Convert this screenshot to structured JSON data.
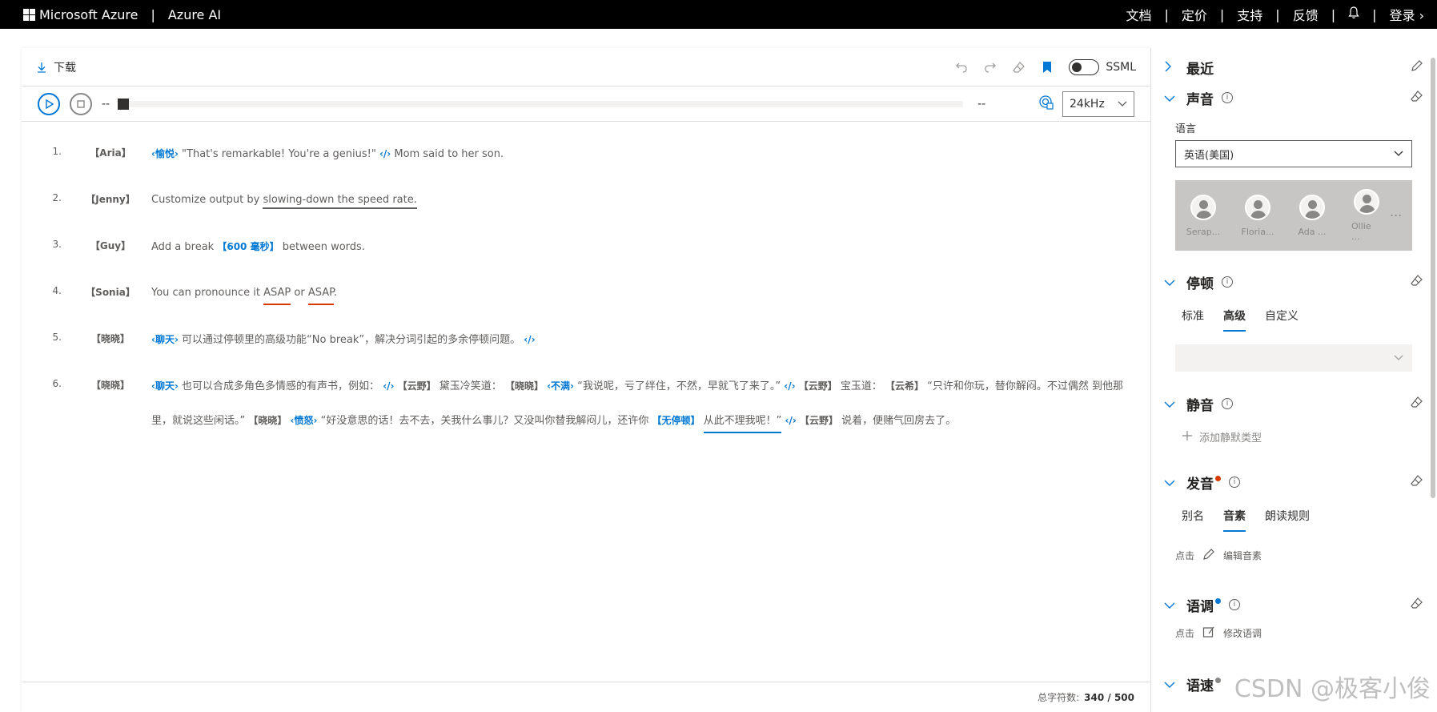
{
  "topbar": {
    "brand": "Microsoft Azure",
    "separator": "|",
    "product": "Azure AI",
    "nav": [
      "文档",
      "定价",
      "支持",
      "反馈"
    ],
    "signin": "登录",
    "bell_icon": "bell-icon"
  },
  "toolbar": {
    "download": "下载",
    "ssml": "SSML"
  },
  "player": {
    "time_current": "--",
    "time_total": "--",
    "sample_rate": "24kHz",
    "progress": 0
  },
  "editor": {
    "lines": [
      {
        "num": "1.",
        "speaker": "【Aria】",
        "parts": [
          "‹愉悦›",
          "\"That's remarkable! You're a genius!\"",
          "‹/›",
          "Mom said to her son."
        ]
      },
      {
        "num": "2.",
        "speaker": "【Jenny】",
        "parts": [
          "Customize output by",
          "slowing-down the speed rate."
        ]
      },
      {
        "num": "3.",
        "speaker": "【Guy】",
        "parts": [
          "Add a break",
          "【600 毫秒】",
          "between words."
        ]
      },
      {
        "num": "4.",
        "speaker": "【Sonia】",
        "parts": [
          "You can pronounce it",
          "ASAP",
          "or",
          "ASAP",
          "."
        ]
      },
      {
        "num": "5.",
        "speaker": "【晓晓】",
        "parts": [
          "‹聊天›",
          "可以通过停顿里的高级功能“No break”，解决分词引起的多余停顿问题。",
          "‹/›"
        ]
      },
      {
        "num": "6.",
        "speaker": "【晓晓】",
        "parts": [
          "‹聊天›",
          "也可以合成多角色多情感的有声书，例如：",
          "‹/›",
          "【云野】",
          "黛玉冷笑道：",
          "【晓晓】",
          "‹不满›",
          "“我说呢，亏了绊住，不然，早就飞了来了。”",
          "‹/›",
          "【云野】",
          "宝玉道：",
          "【云希】",
          "“只许和你玩，替你解闷。不过偶然",
          "到他那里，就说这些闲话。”",
          "【晓晓】",
          "‹愤怒›",
          "“好没意思的话！去不去，关我什么事儿？又没叫你替我解闷儿，还许你",
          "【无停顿】",
          "从此不理我呢！”",
          "‹/›",
          "【云野】",
          "说着，便赌气回房去了。"
        ]
      }
    ]
  },
  "footer": {
    "label": "总字符数:",
    "count": "340 / 500"
  },
  "sidebar": {
    "recent": "最近",
    "voice": {
      "title": "声音",
      "lang_label": "语言",
      "lang_value": "英语(美国)",
      "voices": [
        "Serap...",
        "Floria...",
        "Ada ...",
        "Ollie ..."
      ],
      "more": "..."
    },
    "pause": {
      "title": "停顿",
      "tabs": [
        "标准",
        "高级",
        "自定义"
      ],
      "active_tab": 1
    },
    "silence": {
      "title": "静音",
      "add": "添加静默类型"
    },
    "pronunciation": {
      "title": "发音",
      "tabs": [
        "别名",
        "音素",
        "朗读规则"
      ],
      "active_tab": 1,
      "click": "点击",
      "edit": "编辑音素"
    },
    "intonation": {
      "title": "语调",
      "click": "点击",
      "edit": "修改语调"
    },
    "speed": {
      "title": "语速"
    }
  },
  "watermark": "CSDN @极客小俊",
  "colors": {
    "accent": "#0078d4",
    "warning": "#d83b01",
    "topbar": "#000000"
  }
}
